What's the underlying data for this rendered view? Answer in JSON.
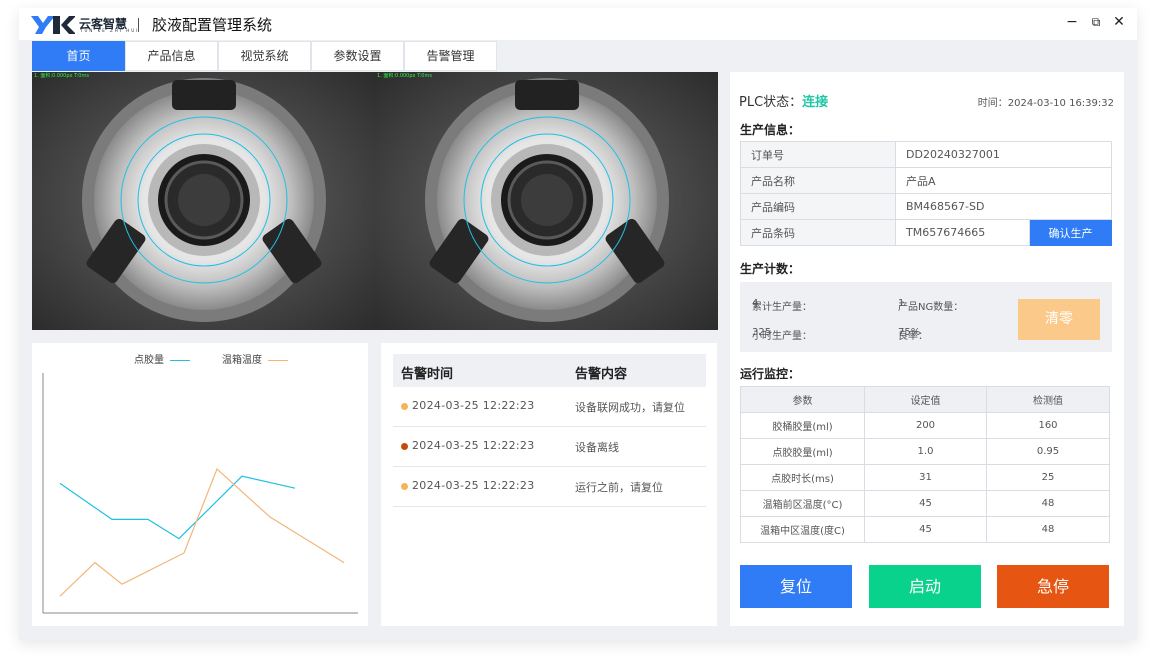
{
  "app": {
    "logo_cn": "云客智慧",
    "logo_en": "YUN KE ZHI HUI",
    "title": "胶液配置管理系统",
    "controls": {
      "minimize": "−",
      "restore": "⧉",
      "close": "✕"
    }
  },
  "tabs": [
    {
      "label": "首页",
      "active": true
    },
    {
      "label": "产品信息"
    },
    {
      "label": "视觉系统"
    },
    {
      "label": "参数设置"
    },
    {
      "label": "告警管理"
    }
  ],
  "cameras": [
    {
      "caption": "1. 面积:0.000px  T:0ms"
    },
    {
      "caption": "1. 面积:0.000px  T:0ms"
    }
  ],
  "chart_data": {
    "type": "line",
    "title": "",
    "xlabel": "",
    "ylabel": "",
    "ylim": [
      0,
      100
    ],
    "legend_position": "top",
    "series": [
      {
        "name": "点胶量",
        "color": "#1ec0e6",
        "values": [
          54,
          39,
          39,
          31,
          57,
          52
        ]
      },
      {
        "name": "温箱温度",
        "color": "#f2b67a",
        "values": [
          7,
          21,
          12,
          25,
          60,
          40,
          21
        ]
      }
    ]
  },
  "alarms": {
    "col_time": "告警时间",
    "col_content": "告警内容",
    "rows": [
      {
        "time": "2024-03-25 12:22:23",
        "content": "设备联网成功，请复位",
        "level_color": "#f5b557"
      },
      {
        "time": "2024-03-25 12:22:23",
        "content": "设备离线",
        "level_color": "#c54a0a"
      },
      {
        "time": "2024-03-25 12:22:23",
        "content": "运行之前，请复位",
        "level_color": "#f5b557"
      }
    ]
  },
  "status": {
    "plc_label": "PLC状态：",
    "plc_value": "连接",
    "plc_color": "#1fc7a2",
    "time_label": "时间：",
    "time_value": "2024-03-10 16:39:32"
  },
  "production_info": {
    "heading": "生产信息：",
    "rows": [
      {
        "key": "订单号",
        "value": "DD20240327001"
      },
      {
        "key": "产品名称",
        "value": "产品A"
      },
      {
        "key": "产品编码",
        "value": "BM468567-SD"
      },
      {
        "key": "产品条码",
        "value": "TM657674665"
      }
    ],
    "confirm_label": "确认生产"
  },
  "production_count": {
    "heading": "生产计数：",
    "total_label": "累计生产量：",
    "total": "4",
    "ng_label": "产品NG数量：",
    "ng": "1",
    "hourly_label": "小时生产量：",
    "hourly": "325",
    "yield_label": "良率：",
    "yield": "75%",
    "clear_label": "清零"
  },
  "monitor": {
    "heading": "运行监控：",
    "columns": [
      "参数",
      "设定值",
      "检测值"
    ],
    "rows": [
      [
        "胶桶胶量(ml)",
        "200",
        "160"
      ],
      [
        "点胶胶量(ml)",
        "1.0",
        "0.95"
      ],
      [
        "点胶时长(ms)",
        "31",
        "25"
      ],
      [
        "温箱前区温度(°C)",
        "45",
        "48"
      ],
      [
        "温箱中区温度(度C)",
        "45",
        "48"
      ]
    ]
  },
  "actions": {
    "reset": {
      "label": "复位",
      "color": "#2f7cf6"
    },
    "start": {
      "label": "启动",
      "color": "#08d28c"
    },
    "estop": {
      "label": "急停",
      "color": "#e75512"
    }
  }
}
